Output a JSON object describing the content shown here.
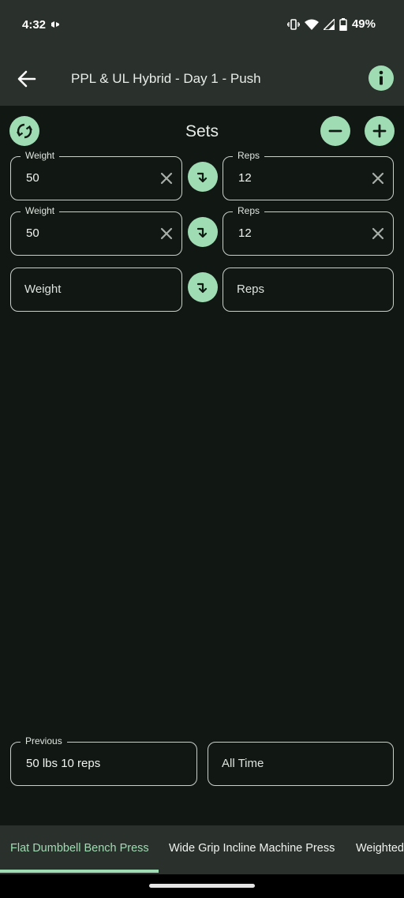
{
  "status": {
    "time": "4:32",
    "battery": "49%"
  },
  "app_bar": {
    "title": "PPL & UL Hybrid - Day 1 - Push",
    "back_icon": "arrow-left-icon",
    "info_icon": "info-icon"
  },
  "header": {
    "title": "Sets"
  },
  "sets": [
    {
      "weight_label": "Weight",
      "weight_value": "50",
      "reps_label": "Reps",
      "reps_value": "12"
    },
    {
      "weight_label": "Weight",
      "weight_value": "50",
      "reps_label": "Reps",
      "reps_value": "12"
    },
    {
      "weight_placeholder": "Weight",
      "reps_placeholder": "Reps"
    }
  ],
  "history": {
    "previous_label": "Previous",
    "previous_value": "50 lbs 10 reps",
    "range_value": "All Time"
  },
  "tabs": [
    {
      "label": "Flat Dumbbell Bench Press",
      "active": true
    },
    {
      "label": "Wide Grip Incline Machine Press",
      "active": false
    },
    {
      "label": "Weighted",
      "active": false
    }
  ],
  "colors": {
    "accent": "#9fdcb3",
    "background": "#111813",
    "bar": "#2a302b"
  }
}
